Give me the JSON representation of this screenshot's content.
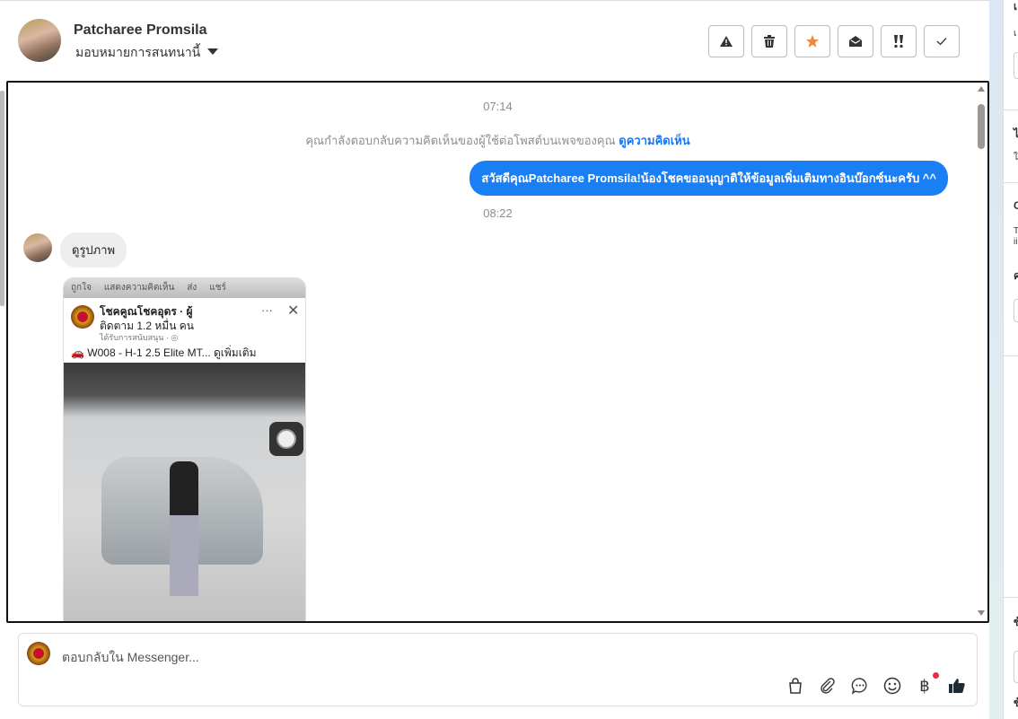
{
  "header": {
    "contact_name": "Patcharee Promsila",
    "assign_label": "มอบหมายการสนทนานี้",
    "actions": [
      {
        "name": "report-spam",
        "icon": "warning-icon"
      },
      {
        "name": "delete",
        "icon": "trash-icon"
      },
      {
        "name": "star",
        "icon": "star-icon",
        "color": "#f0883a"
      },
      {
        "name": "mark-unread",
        "icon": "envelope-open-icon"
      },
      {
        "name": "follow-up",
        "icon": "exclamation-icon"
      },
      {
        "name": "done",
        "icon": "check-icon"
      }
    ]
  },
  "chat": {
    "time1": "07:14",
    "note_text": "คุณกำลังตอบกลับความคิดเห็นของผู้ใช้ต่อโพสต์บนเพจของคุณ",
    "note_link": "ดูความคิดเห็น",
    "outgoing": "สวัสดีคุณPatcharee Promsila!น้องโชคขออนุญาติให้ข้อมูลเพิ่มเติมทางอินบ๊อกซ์นะครับ ^^",
    "time2": "08:22",
    "incoming": "ดูรูปภาพ",
    "screenshot": {
      "bar_items": [
        "ถูกใจ",
        "แสดงความคิดเห็น",
        "ส่ง",
        "แชร์"
      ],
      "page_name": "โชคคูณโชคอุดร · ผู้",
      "followers": "ติดตาม 1.2 หมื่น คน",
      "sponsored": "ได้รับการสนับสนุน · ◎",
      "post_text": "🚗 W008 - H-1 2.5 Elite MT... ดูเพิ่มเติม"
    }
  },
  "composer": {
    "placeholder": "ตอบกลับใน Messenger...",
    "tools": [
      "bag-icon",
      "paperclip-icon",
      "chat-bubble-icon",
      "emoji-icon",
      "baht-icon",
      "thumbs-up-icon"
    ],
    "accent": "#1a7ef5"
  },
  "side": {
    "fragments": [
      "เ",
      "เ",
      "ไ",
      "ใ",
      "C",
      "T",
      "ii",
      "ค",
      "ข้",
      "ข้"
    ]
  }
}
